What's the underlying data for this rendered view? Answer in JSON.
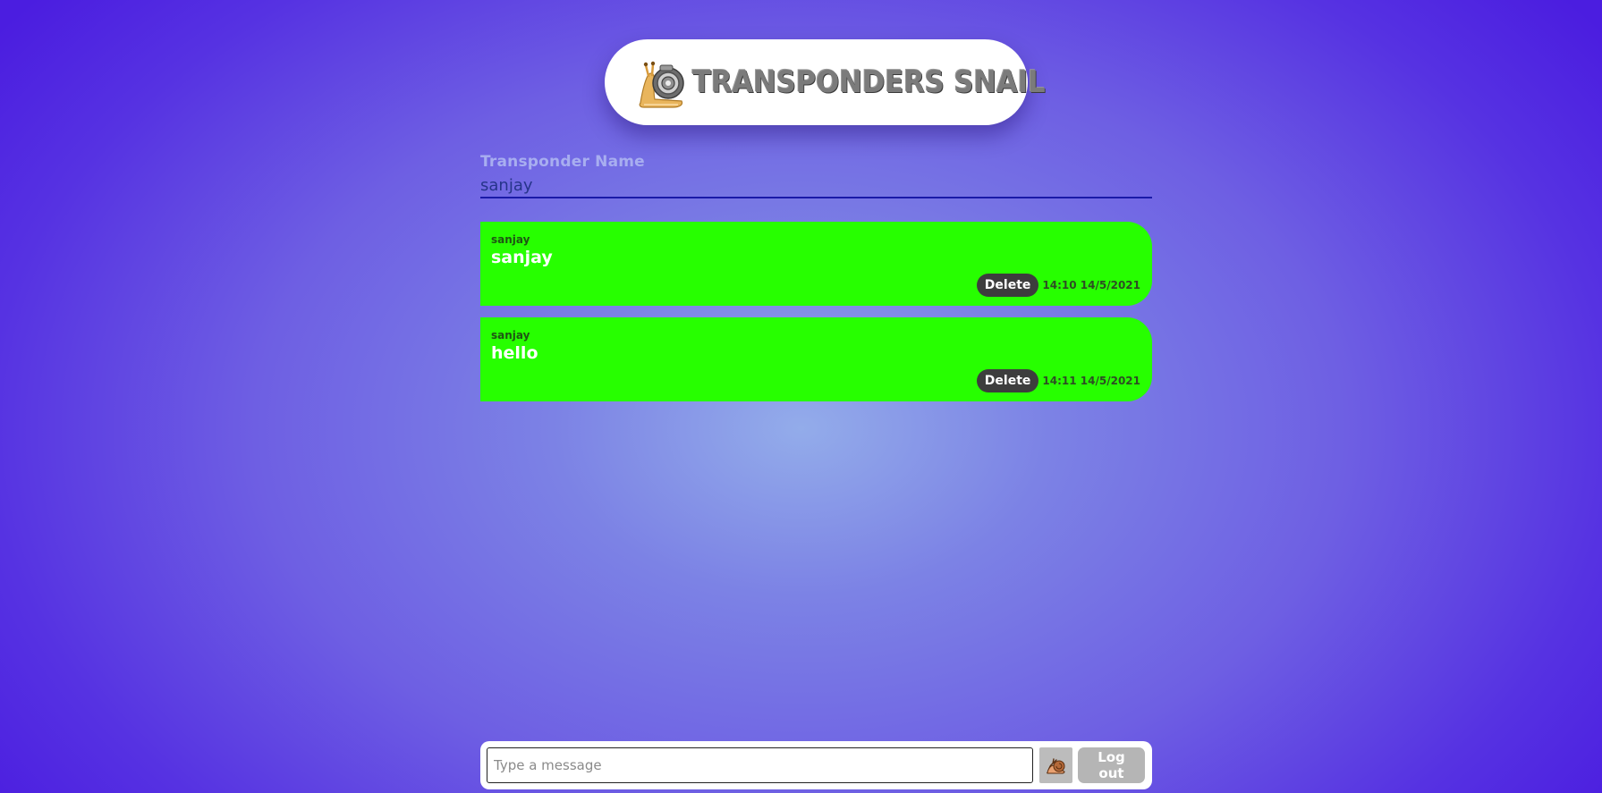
{
  "header": {
    "title": "TRANSPONDERS SNAIL",
    "logo_icon": "snail-transponder-logo-icon"
  },
  "name_field": {
    "label": "Transponder Name",
    "value": "sanjay"
  },
  "messages": [
    {
      "sender": "sanjay",
      "text": "sanjay",
      "delete_label": "Delete",
      "time": "14:10 14/5/2021"
    },
    {
      "sender": "sanjay",
      "text": "hello",
      "delete_label": "Delete",
      "time": "14:11 14/5/2021"
    }
  ],
  "composer": {
    "placeholder": "Type a message",
    "emoji_icon": "snail-emoji-icon",
    "logout_label": "Log out"
  },
  "colors": {
    "message_bubble": "#27ff00",
    "delete_button": "#3d3d3d",
    "background_edge": "#4b1de0",
    "background_center": "#93acea",
    "logout_button": "#b5b5b5"
  }
}
